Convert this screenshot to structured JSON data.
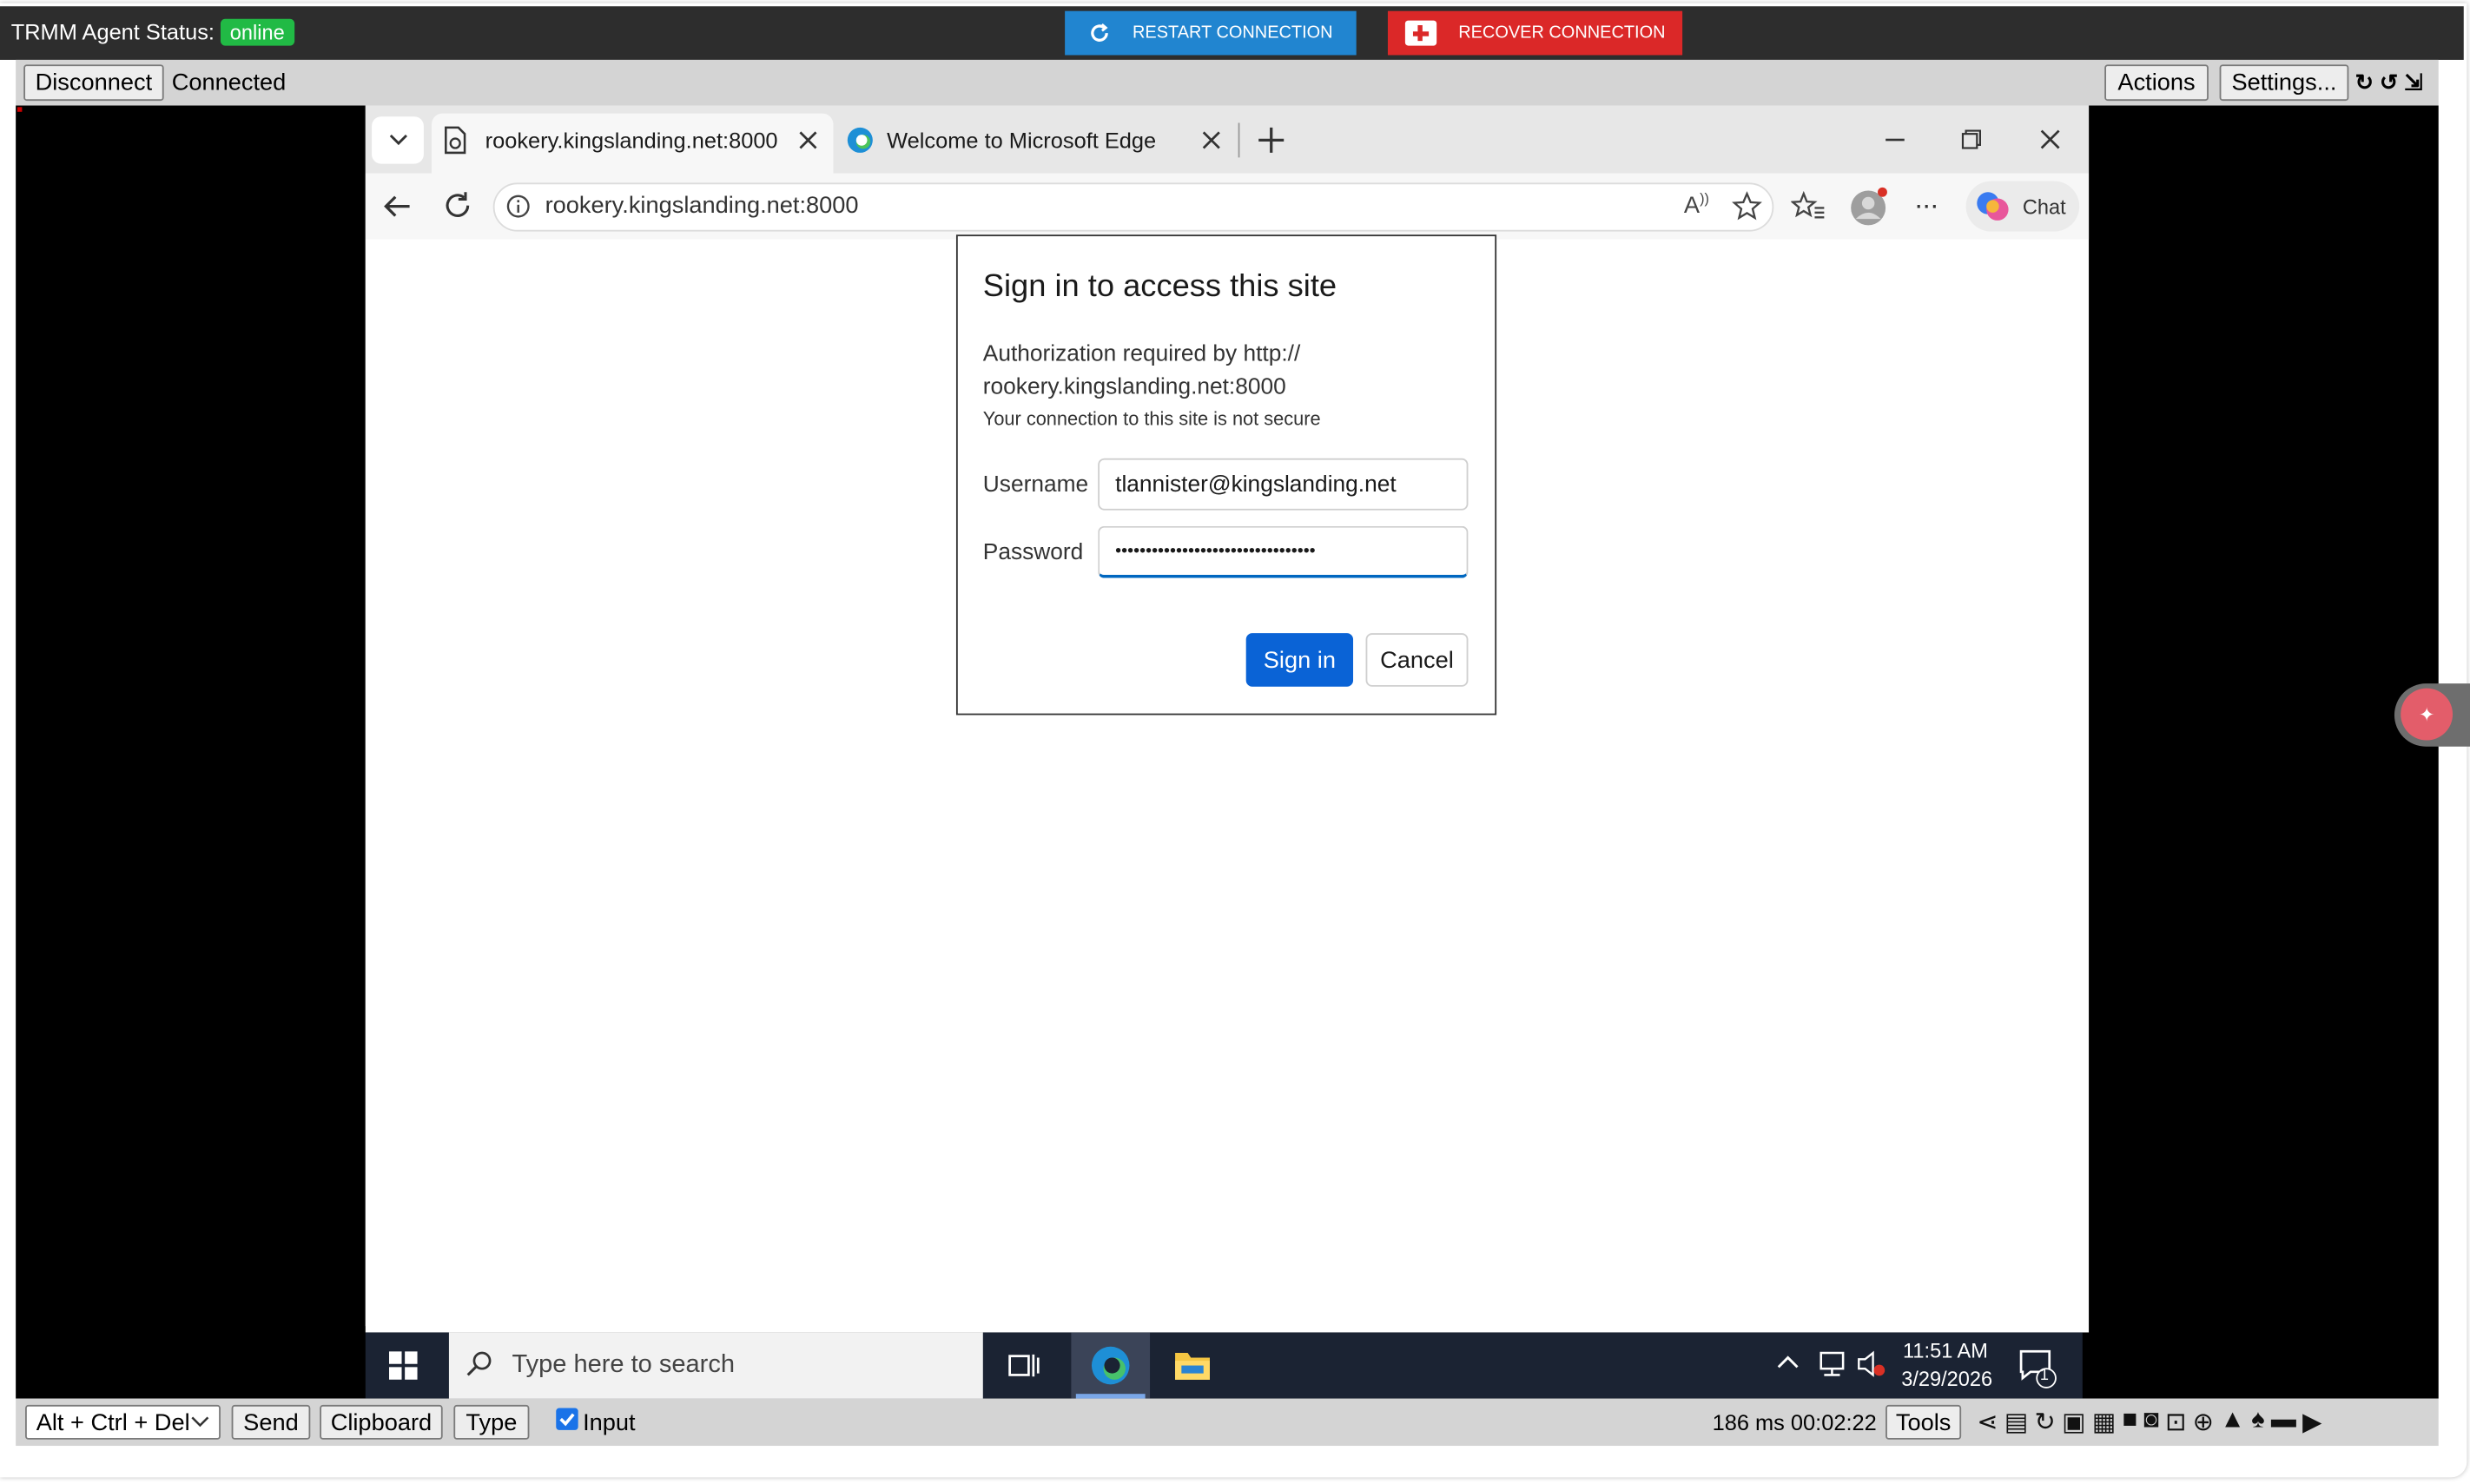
{
  "topbar": {
    "agent_label": "TRMM Agent Status:",
    "status": "online",
    "restart_label": "RESTART CONNECTION",
    "recover_label": "RECOVER CONNECTION"
  },
  "toolbar": {
    "disconnect": "Disconnect",
    "state": "Connected",
    "actions": "Actions",
    "settings": "Settings...",
    "mini_icons": "↻ ↺ ⇲"
  },
  "browser": {
    "tabs": [
      {
        "title": "rookery.kingslanding.net:8000"
      },
      {
        "title": "Welcome to Microsoft Edge"
      }
    ],
    "url": "rookery.kingslanding.net:8000",
    "chat_label": "Chat"
  },
  "dialog": {
    "title": "Sign in to access this site",
    "auth_line1": "Authorization required by http://",
    "auth_line2": "rookery.kingslanding.net:8000",
    "insecure": "Your connection to this site is not secure",
    "username_label": "Username",
    "username_value": "tlannister@kingslanding.net",
    "password_label": "Password",
    "password_value": "•••••••••••••••••••••••••••••••••",
    "signin": "Sign in",
    "cancel": "Cancel"
  },
  "taskbar": {
    "search_placeholder": "Type here to search",
    "time": "11:51 AM",
    "date": "3/29/2026",
    "notification_count": "1"
  },
  "bottombar": {
    "keycombo": "Alt + Ctrl + Del",
    "send": "Send",
    "clipboard": "Clipboard",
    "type": "Type",
    "input_label": "Input",
    "latency": "186 ms 00:02:22",
    "tools": "Tools"
  },
  "colors": {
    "online_badge": "#21ba45",
    "restart": "#2185d0",
    "recover": "#db2828",
    "signin": "#0a63d6"
  }
}
